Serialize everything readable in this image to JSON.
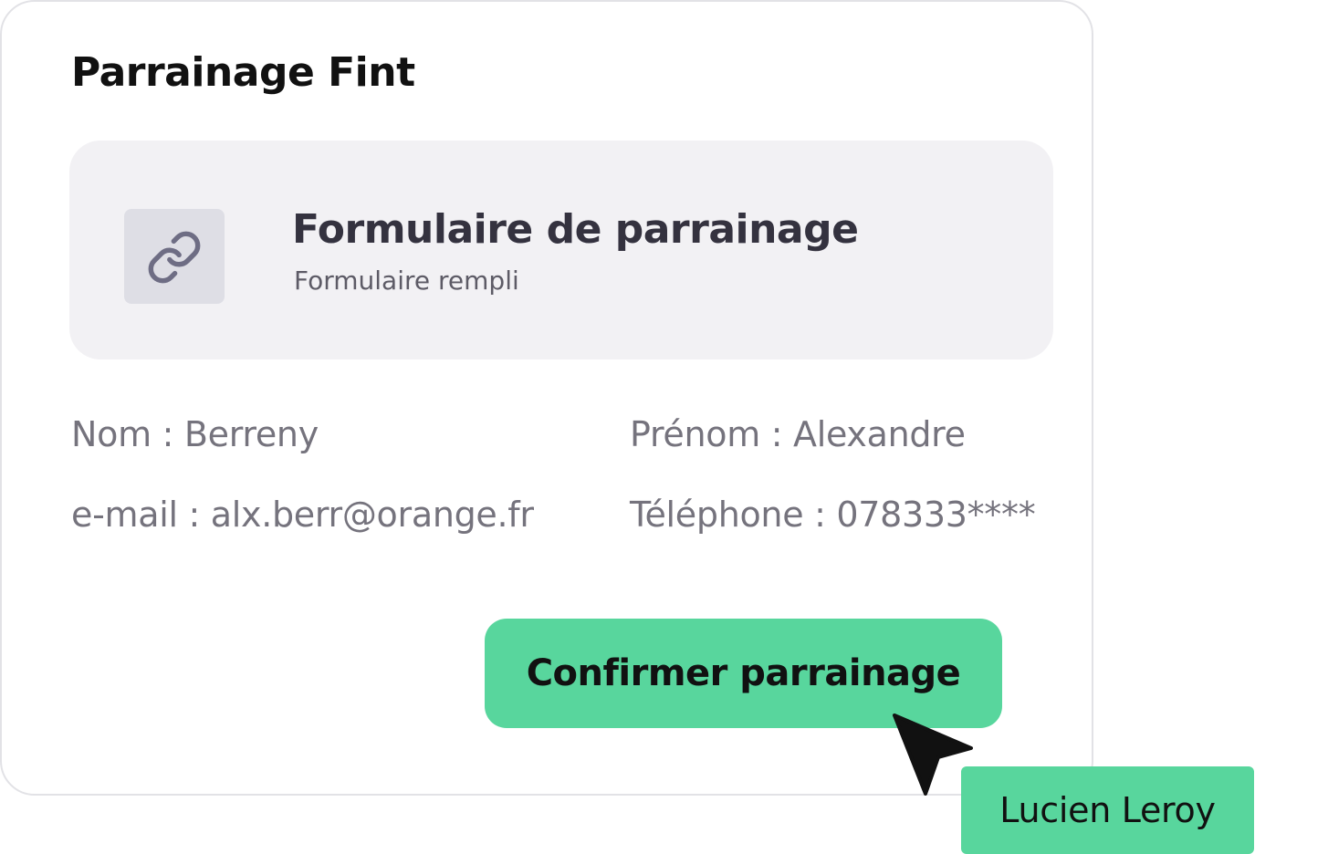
{
  "card": {
    "title": "Parrainage Fint"
  },
  "form_panel": {
    "icon": "link-icon",
    "title": "Formulaire de parrainage",
    "subtitle": "Formulaire rempli"
  },
  "fields": {
    "nom": "Nom : Berreny",
    "prenom": "Prénom : Alexandre",
    "email": "e-mail : alx.berr@orange.fr",
    "telephone": "Téléphone : 078333****"
  },
  "confirm_button": {
    "label": "Confirmer parrainage"
  },
  "cursor": {
    "icon": "mouse-pointer-icon",
    "user_label": "Lucien Leroy"
  },
  "colors": {
    "accent_green": "#58d69d",
    "panel_bg": "#f2f1f4",
    "icon_tile_bg": "#dedee5",
    "icon_stroke": "#6e6d84",
    "text_muted": "#75737d"
  }
}
